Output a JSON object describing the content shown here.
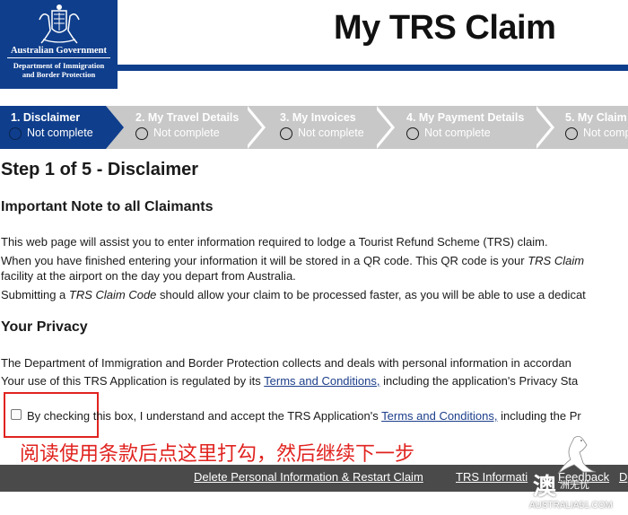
{
  "header": {
    "gov_name": "Australian Government",
    "dept_line1": "Department of Immigration",
    "dept_line2": "and Border Protection",
    "title": "My TRS Claim",
    "brand_color": "#0f3e8c"
  },
  "steps": [
    {
      "label": "1. Disclaimer",
      "status": "Not complete",
      "active": true
    },
    {
      "label": "2. My Travel Details",
      "status": "Not complete",
      "active": false
    },
    {
      "label": "3. My Invoices",
      "status": "Not complete",
      "active": false
    },
    {
      "label": "4. My Payment Details",
      "status": "Not complete",
      "active": false
    },
    {
      "label": "5. My Claim",
      "status": "Not comp",
      "active": false
    }
  ],
  "content": {
    "step_title": "Step 1 of 5 - Disclaimer",
    "important_heading": "Important Note to all Claimants",
    "para1": "This web page will assist you to enter information required to lodge a Tourist Refund Scheme (TRS) claim.",
    "para2_start": "When you have finished entering your information it will be stored in a QR code. This QR code is your ",
    "para2_italic": "TRS Claim",
    "para3": "facility at the airport on the day you depart from Australia.",
    "para4_start": "Submitting a ",
    "para4_italic": "TRS Claim Code",
    "para4_end": " should allow your claim to be processed faster, as you will be able to use a dedicat",
    "privacy_heading": "Your Privacy",
    "privacy1": "The Department of Immigration and Border Protection collects and deals with personal information in accordan",
    "privacy2_start": "Your use of this TRS Application is regulated by its ",
    "privacy2_link": "Terms and Conditions,",
    "privacy2_end": " including the application's Privacy Sta",
    "checkbox_start": "By checking this box, I understand and accept the TRS Application's ",
    "checkbox_link": "Terms and Conditions,",
    "checkbox_end": " including the Pr",
    "annotation": "阅读使用条款后点这里打勾，然后继续下一步",
    "annotation_color": "#e0231f"
  },
  "footer": {
    "link1": "Delete Personal Information & Restart Claim",
    "link2": "TRS Informati",
    "link3": "Feedback",
    "link4": "D"
  },
  "watermark": {
    "cn": "澳",
    "sub": "洲无忧",
    "domain": "AUSTRALIA51.COM"
  }
}
